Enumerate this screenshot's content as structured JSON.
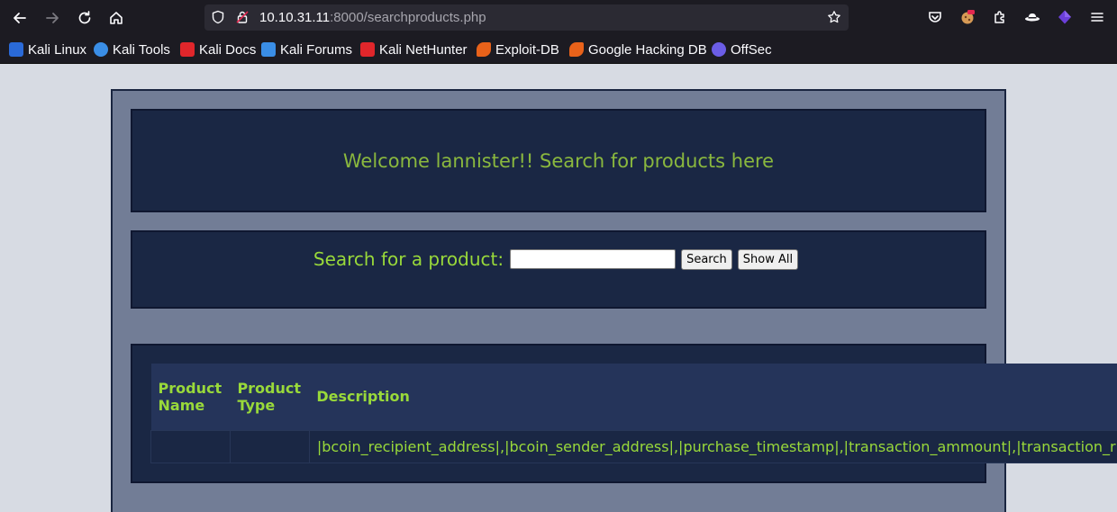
{
  "browser": {
    "url_host": "10.10.31.11",
    "url_rest": ":8000/searchproducts.php",
    "bookmarks": [
      {
        "label": "Kali Linux",
        "color": "#367bf0"
      },
      {
        "label": "Kali Tools",
        "color": "#3a8ee6"
      },
      {
        "label": "Kali Docs",
        "color": "#e0262b"
      },
      {
        "label": "Kali Forums",
        "color": "#3a8ee6"
      },
      {
        "label": "Kali NetHunter",
        "color": "#e0262b"
      },
      {
        "label": "Exploit-DB",
        "color": "#e8621a"
      },
      {
        "label": "Google Hacking DB",
        "color": "#e8621a"
      },
      {
        "label": "OffSec",
        "color": "#6b5de6"
      }
    ]
  },
  "page": {
    "welcome": "Welcome lannister!! Search for products here",
    "search_label": "Search for a product:",
    "search_value": "",
    "search_button": "Search",
    "show_all_button": "Show All"
  },
  "table": {
    "headers": [
      "Product Name",
      "Product Type",
      "Description"
    ],
    "rows": [
      [
        "",
        "",
        "|bcoin_recipient_address|,|bcoin_sender_address|,|purchase_timestamp|,|transaction_ammount|,|transaction_r"
      ]
    ]
  },
  "colors": {
    "accent_green": "#99d93a",
    "panel_bg": "#1a2744",
    "wrapper_bg": "#727d96"
  }
}
